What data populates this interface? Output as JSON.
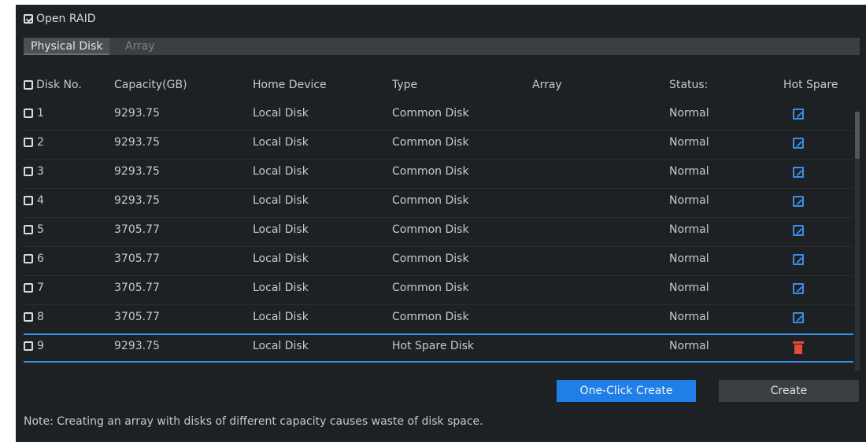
{
  "top": {
    "open_raid_label": "Open RAID",
    "open_raid_checked": true
  },
  "tabs": [
    {
      "label": "Physical Disk",
      "active": true
    },
    {
      "label": "Array",
      "active": false
    }
  ],
  "table": {
    "headers": {
      "disk_no": "Disk No.",
      "capacity": "Capacity(GB)",
      "home_device": "Home Device",
      "type": "Type",
      "array": "Array",
      "status": "Status:",
      "hot_spare": "Hot Spare"
    },
    "rows": [
      {
        "no": "1",
        "capacity": "9293.75",
        "home": "Local Disk",
        "type": "Common Disk",
        "array": "",
        "status": "Normal",
        "hot_spare_icon": "edit-icon"
      },
      {
        "no": "2",
        "capacity": "9293.75",
        "home": "Local Disk",
        "type": "Common Disk",
        "array": "",
        "status": "Normal",
        "hot_spare_icon": "edit-icon"
      },
      {
        "no": "3",
        "capacity": "9293.75",
        "home": "Local Disk",
        "type": "Common Disk",
        "array": "",
        "status": "Normal",
        "hot_spare_icon": "edit-icon"
      },
      {
        "no": "4",
        "capacity": "9293.75",
        "home": "Local Disk",
        "type": "Common Disk",
        "array": "",
        "status": "Normal",
        "hot_spare_icon": "edit-icon"
      },
      {
        "no": "5",
        "capacity": "3705.77",
        "home": "Local Disk",
        "type": "Common Disk",
        "array": "",
        "status": "Normal",
        "hot_spare_icon": "edit-icon"
      },
      {
        "no": "6",
        "capacity": "3705.77",
        "home": "Local Disk",
        "type": "Common Disk",
        "array": "",
        "status": "Normal",
        "hot_spare_icon": "edit-icon"
      },
      {
        "no": "7",
        "capacity": "3705.77",
        "home": "Local Disk",
        "type": "Common Disk",
        "array": "",
        "status": "Normal",
        "hot_spare_icon": "edit-icon"
      },
      {
        "no": "8",
        "capacity": "3705.77",
        "home": "Local Disk",
        "type": "Common Disk",
        "array": "",
        "status": "Normal",
        "hot_spare_icon": "edit-icon"
      },
      {
        "no": "9",
        "capacity": "9293.75",
        "home": "Local Disk",
        "type": "Hot Spare Disk",
        "array": "",
        "status": "Normal",
        "hot_spare_icon": "trash-icon"
      }
    ]
  },
  "buttons": {
    "one_click_create": "One-Click Create",
    "create": "Create"
  },
  "note": "Note: Creating an array with disks of different capacity causes waste of disk space.",
  "colors": {
    "accent": "#1f7fe6",
    "delete": "#e24a3a",
    "panel_bg": "#1e2124"
  }
}
